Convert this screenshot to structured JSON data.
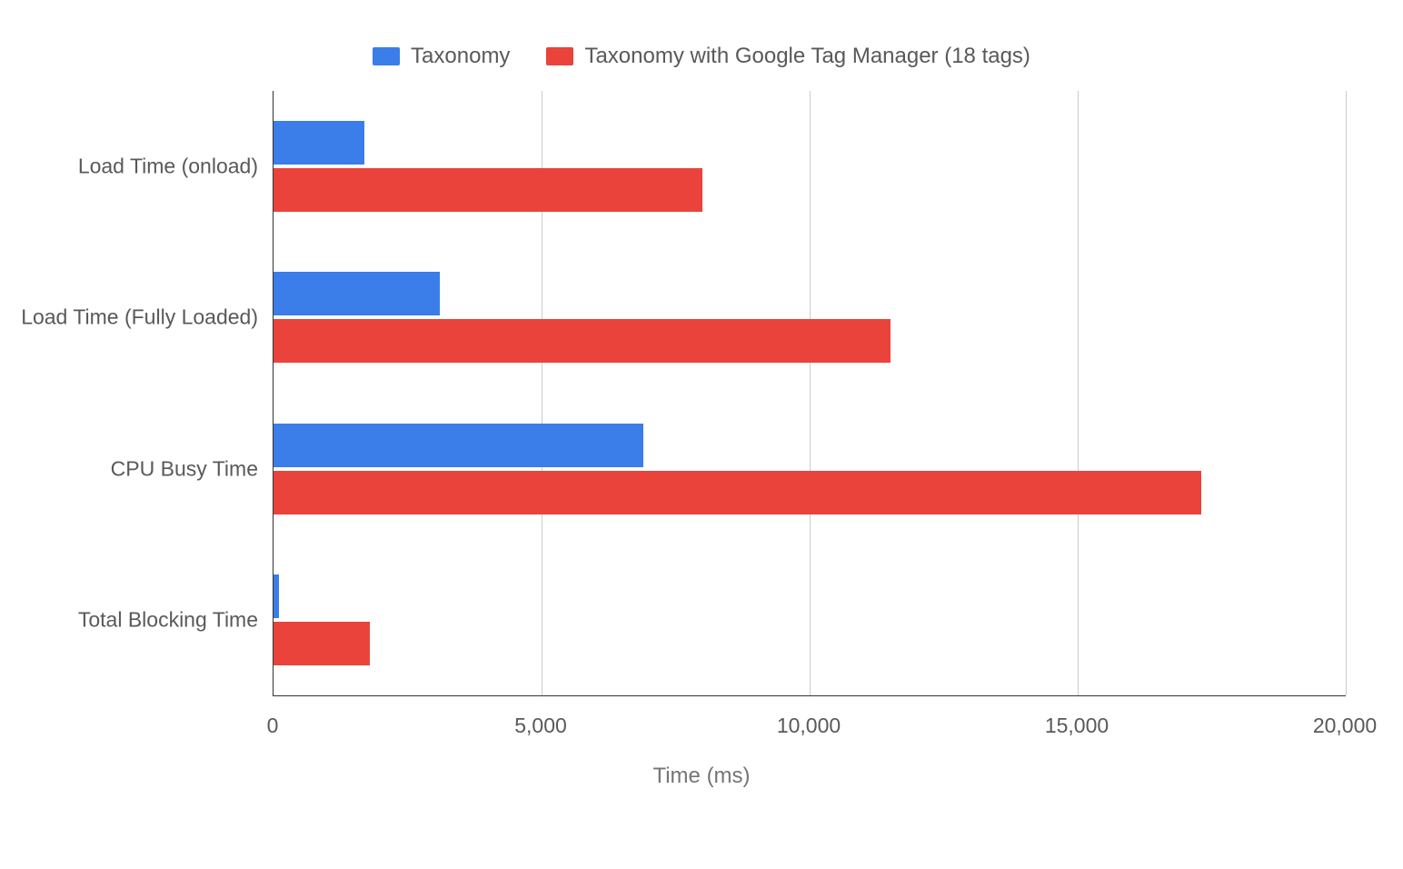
{
  "chart_data": {
    "type": "bar",
    "orientation": "horizontal",
    "categories": [
      "Load Time (onload)",
      "Load Time (Fully Loaded)",
      "CPU Busy Time",
      "Total Blocking Time"
    ],
    "series": [
      {
        "name": "Taxonomy",
        "color": "#3B7DE9",
        "values": [
          1700,
          3100,
          6900,
          100
        ]
      },
      {
        "name": "Taxonomy with Google Tag Manager (18 tags)",
        "color": "#E9433B",
        "values": [
          8000,
          11500,
          17300,
          1800
        ]
      }
    ],
    "xlabel": "Time (ms)",
    "ylabel": "",
    "xlim": [
      0,
      20000
    ],
    "x_ticks": [
      0,
      5000,
      10000,
      15000,
      20000
    ],
    "x_tick_labels": [
      "0",
      "5,000",
      "10,000",
      "15,000",
      "20,000"
    ],
    "grid": {
      "x": true,
      "y": false
    },
    "legend_position": "top-center"
  }
}
